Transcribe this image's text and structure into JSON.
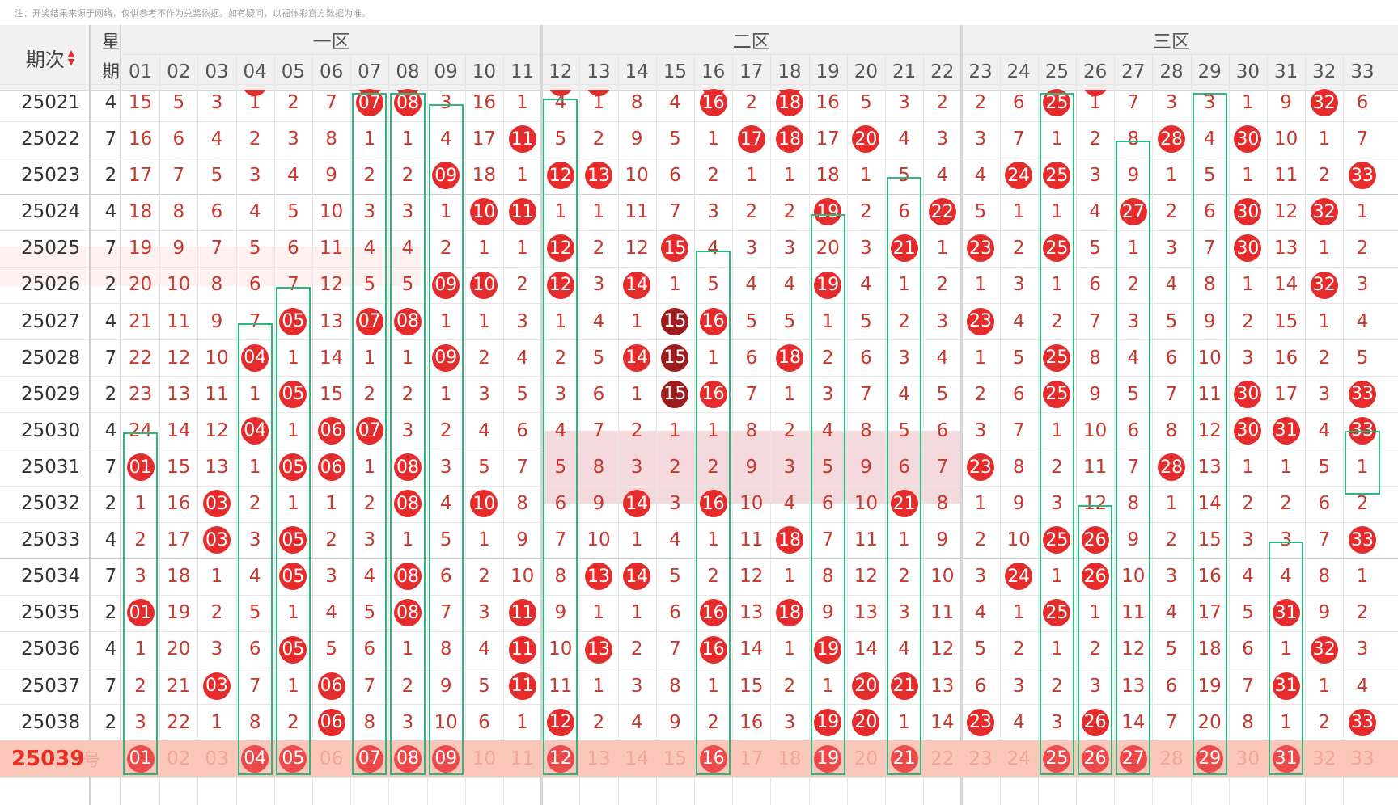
{
  "notice": "注：开奖结果来源于网络，仅供参考不作为兑奖依据。如有疑问，以福体彩官方数据为准。",
  "header": {
    "issue_label": "期次",
    "week_label_1": "星",
    "week_label_2": "期",
    "zones": [
      "一区",
      "二区",
      "三区"
    ],
    "numbers": [
      "01",
      "02",
      "03",
      "04",
      "05",
      "06",
      "07",
      "08",
      "09",
      "10",
      "11",
      "12",
      "13",
      "14",
      "15",
      "16",
      "17",
      "18",
      "19",
      "20",
      "21",
      "22",
      "23",
      "24",
      "25",
      "26",
      "27",
      "28",
      "29",
      "30",
      "31",
      "32",
      "33"
    ]
  },
  "rows": [
    {
      "issue": "25021",
      "week": "4",
      "cells": [
        "15",
        "5",
        "3",
        "1",
        "2",
        "7",
        "07",
        "08",
        "3",
        "16",
        "1",
        "4",
        "1",
        "8",
        "4",
        "16",
        "2",
        "18",
        "16",
        "5",
        "3",
        "2",
        "2",
        "6",
        "25",
        "1",
        "7",
        "3",
        "3",
        "1",
        "9",
        "32",
        "6"
      ]
    },
    {
      "issue": "25022",
      "week": "7",
      "cells": [
        "16",
        "6",
        "4",
        "2",
        "3",
        "8",
        "1",
        "1",
        "4",
        "17",
        "11",
        "5",
        "2",
        "9",
        "5",
        "1",
        "17",
        "18",
        "17",
        "20",
        "4",
        "3",
        "3",
        "7",
        "1",
        "2",
        "8",
        "28",
        "4",
        "30",
        "10",
        "1",
        "7"
      ]
    },
    {
      "issue": "25023",
      "week": "2",
      "cells": [
        "17",
        "7",
        "5",
        "3",
        "4",
        "9",
        "2",
        "2",
        "09",
        "18",
        "1",
        "12",
        "13",
        "10",
        "6",
        "2",
        "1",
        "1",
        "18",
        "1",
        "5",
        "4",
        "4",
        "24",
        "25",
        "3",
        "9",
        "1",
        "5",
        "1",
        "11",
        "2",
        "33"
      ]
    },
    {
      "issue": "25024",
      "week": "4",
      "cells": [
        "18",
        "8",
        "6",
        "4",
        "5",
        "10",
        "3",
        "3",
        "1",
        "10",
        "11",
        "1",
        "1",
        "11",
        "7",
        "3",
        "2",
        "2",
        "19",
        "2",
        "6",
        "22",
        "5",
        "1",
        "1",
        "4",
        "27",
        "2",
        "6",
        "30",
        "12",
        "32",
        "1"
      ]
    },
    {
      "issue": "25025",
      "week": "7",
      "cells": [
        "19",
        "9",
        "7",
        "5",
        "6",
        "11",
        "4",
        "4",
        "2",
        "1",
        "1",
        "12",
        "2",
        "12",
        "15",
        "4",
        "3",
        "3",
        "20",
        "3",
        "21",
        "1",
        "23",
        "2",
        "25",
        "5",
        "1",
        "3",
        "7",
        "30",
        "13",
        "1",
        "2"
      ]
    },
    {
      "issue": "25026",
      "week": "2",
      "cells": [
        "20",
        "10",
        "8",
        "6",
        "7",
        "12",
        "5",
        "5",
        "09",
        "10",
        "2",
        "12",
        "3",
        "14",
        "1",
        "5",
        "4",
        "4",
        "19",
        "4",
        "1",
        "2",
        "1",
        "3",
        "1",
        "6",
        "2",
        "4",
        "8",
        "1",
        "14",
        "32",
        "3"
      ]
    },
    {
      "issue": "25027",
      "week": "4",
      "cells": [
        "21",
        "11",
        "9",
        "7",
        "05",
        "13",
        "07",
        "08",
        "1",
        "1",
        "3",
        "1",
        "4",
        "1",
        "15",
        "16",
        "5",
        "5",
        "1",
        "5",
        "2",
        "3",
        "23",
        "4",
        "2",
        "7",
        "3",
        "5",
        "9",
        "2",
        "15",
        "1",
        "4"
      ]
    },
    {
      "issue": "25028",
      "week": "7",
      "cells": [
        "22",
        "12",
        "10",
        "04",
        "1",
        "14",
        "1",
        "1",
        "09",
        "2",
        "4",
        "2",
        "5",
        "14",
        "15",
        "1",
        "6",
        "18",
        "2",
        "6",
        "3",
        "4",
        "1",
        "5",
        "25",
        "8",
        "4",
        "6",
        "10",
        "3",
        "16",
        "2",
        "5"
      ]
    },
    {
      "issue": "25029",
      "week": "2",
      "cells": [
        "23",
        "13",
        "11",
        "1",
        "05",
        "15",
        "2",
        "2",
        "1",
        "3",
        "5",
        "3",
        "6",
        "1",
        "15",
        "16",
        "7",
        "1",
        "3",
        "7",
        "4",
        "5",
        "2",
        "6",
        "25",
        "9",
        "5",
        "7",
        "11",
        "30",
        "17",
        "3",
        "33"
      ]
    },
    {
      "issue": "25030",
      "week": "4",
      "cells": [
        "24",
        "14",
        "12",
        "04",
        "1",
        "06",
        "07",
        "3",
        "2",
        "4",
        "6",
        "4",
        "7",
        "2",
        "1",
        "1",
        "8",
        "2",
        "4",
        "8",
        "5",
        "6",
        "3",
        "7",
        "1",
        "10",
        "6",
        "8",
        "12",
        "30",
        "31",
        "4",
        "33"
      ]
    },
    {
      "issue": "25031",
      "week": "7",
      "cells": [
        "01",
        "15",
        "13",
        "1",
        "05",
        "06",
        "1",
        "08",
        "3",
        "5",
        "7",
        "5",
        "8",
        "3",
        "2",
        "2",
        "9",
        "3",
        "5",
        "9",
        "6",
        "7",
        "23",
        "8",
        "2",
        "11",
        "7",
        "28",
        "13",
        "1",
        "1",
        "5",
        "1"
      ]
    },
    {
      "issue": "25032",
      "week": "2",
      "cells": [
        "1",
        "16",
        "03",
        "2",
        "1",
        "1",
        "2",
        "08",
        "4",
        "10",
        "8",
        "6",
        "9",
        "14",
        "3",
        "16",
        "10",
        "4",
        "6",
        "10",
        "21",
        "8",
        "1",
        "9",
        "3",
        "12",
        "8",
        "1",
        "14",
        "2",
        "2",
        "6",
        "2"
      ]
    },
    {
      "issue": "25033",
      "week": "4",
      "cells": [
        "2",
        "17",
        "03",
        "3",
        "05",
        "2",
        "3",
        "1",
        "5",
        "1",
        "9",
        "7",
        "10",
        "1",
        "4",
        "1",
        "11",
        "18",
        "7",
        "11",
        "1",
        "9",
        "2",
        "10",
        "25",
        "26",
        "9",
        "2",
        "15",
        "3",
        "3",
        "7",
        "33"
      ]
    },
    {
      "issue": "25034",
      "week": "7",
      "cells": [
        "3",
        "18",
        "1",
        "4",
        "05",
        "3",
        "4",
        "08",
        "6",
        "2",
        "10",
        "8",
        "13",
        "14",
        "5",
        "2",
        "12",
        "1",
        "8",
        "12",
        "2",
        "10",
        "3",
        "24",
        "1",
        "26",
        "10",
        "3",
        "16",
        "4",
        "4",
        "8",
        "1"
      ]
    },
    {
      "issue": "25035",
      "week": "2",
      "cells": [
        "01",
        "19",
        "2",
        "5",
        "1",
        "4",
        "5",
        "08",
        "7",
        "3",
        "11",
        "9",
        "1",
        "1",
        "6",
        "16",
        "13",
        "18",
        "9",
        "13",
        "3",
        "11",
        "4",
        "1",
        "25",
        "1",
        "11",
        "4",
        "17",
        "5",
        "31",
        "9",
        "2"
      ]
    },
    {
      "issue": "25036",
      "week": "4",
      "cells": [
        "1",
        "20",
        "3",
        "6",
        "05",
        "5",
        "6",
        "1",
        "8",
        "4",
        "11",
        "10",
        "13",
        "2",
        "7",
        "16",
        "14",
        "1",
        "19",
        "14",
        "4",
        "12",
        "5",
        "2",
        "1",
        "2",
        "12",
        "5",
        "18",
        "6",
        "1",
        "32",
        "3"
      ]
    },
    {
      "issue": "25037",
      "week": "7",
      "cells": [
        "2",
        "21",
        "03",
        "7",
        "1",
        "06",
        "7",
        "2",
        "9",
        "5",
        "11",
        "11",
        "1",
        "3",
        "8",
        "1",
        "15",
        "2",
        "1",
        "20",
        "21",
        "13",
        "6",
        "3",
        "2",
        "3",
        "13",
        "6",
        "19",
        "7",
        "31",
        "1",
        "4"
      ]
    },
    {
      "issue": "25038",
      "week": "2",
      "cells": [
        "3",
        "22",
        "1",
        "8",
        "2",
        "06",
        "8",
        "3",
        "10",
        "6",
        "1",
        "12",
        "2",
        "4",
        "9",
        "2",
        "16",
        "3",
        "19",
        "20",
        "1",
        "14",
        "23",
        "4",
        "3",
        "26",
        "14",
        "7",
        "20",
        "8",
        "1",
        "2",
        "33"
      ]
    }
  ],
  "current": {
    "issue": "25039",
    "suffix": "号",
    "cells": [
      "01",
      "02",
      "03",
      "04",
      "05",
      "06",
      "07",
      "08",
      "09",
      "10",
      "11",
      "12",
      "13",
      "14",
      "15",
      "16",
      "17",
      "18",
      "19",
      "20",
      "21",
      "22",
      "23",
      "24",
      "25",
      "26",
      "27",
      "28",
      "29",
      "30",
      "31",
      "32",
      "33"
    ],
    "selected": [
      "01",
      "04",
      "05",
      "07",
      "08",
      "09",
      "12",
      "16",
      "19",
      "21",
      "25",
      "26",
      "27",
      "29",
      "31"
    ]
  },
  "dark_balls": [
    [
      6,
      14
    ],
    [
      7,
      14
    ],
    [
      8,
      14
    ]
  ],
  "colors": {
    "ball": "#e52c2c",
    "ball_dark": "#9c1d1d",
    "box": "#2cb77c",
    "current_row": "#fbc7bb"
  }
}
